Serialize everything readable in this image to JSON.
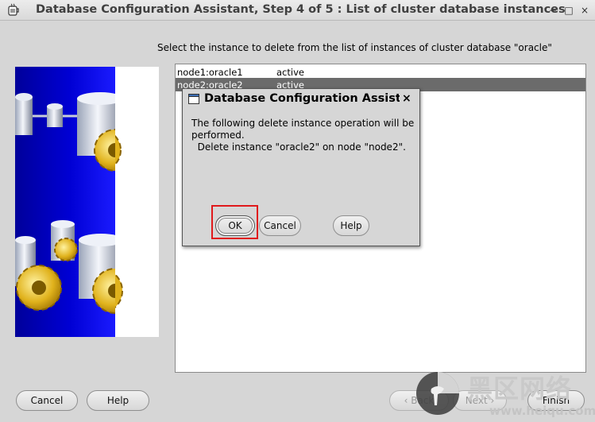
{
  "window": {
    "title": "Database Configuration Assistant, Step 4 of 5 : List of cluster database instances",
    "minimize_glyph": "−",
    "maximize_glyph": "□",
    "close_glyph": "×",
    "icon": "java-cup-icon"
  },
  "prompt": "Select the instance to delete from the list of instances of cluster database \"oracle\"",
  "instances": [
    {
      "name": "node1:oracle1",
      "status": "active"
    },
    {
      "name": "node2:oracle2",
      "status": "active"
    }
  ],
  "selected_instance": "node2:oracle2",
  "footer": {
    "cancel": "Cancel",
    "help": "Help",
    "back": "Back",
    "next": "Next",
    "finish": "Finish"
  },
  "dialog": {
    "title": "Database Configuration Assistant",
    "close_glyph": "×",
    "message_lines": [
      "The following delete instance operation will be",
      "performed.",
      "  Delete instance \"oracle2\" on node \"node2\"."
    ],
    "ok": "OK",
    "cancel": "Cancel",
    "help": "Help"
  },
  "watermark": {
    "text": "黑区网络",
    "url": "www.heiqu.com"
  },
  "colors": {
    "selection": "#6b6b6b",
    "banner_blue": "#0000d4",
    "highlight_red": "#e0191b"
  }
}
